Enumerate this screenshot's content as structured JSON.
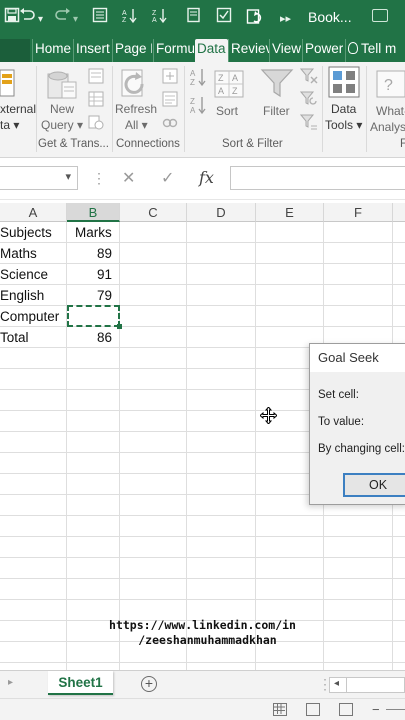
{
  "titlebar": {
    "save_icon": "save-icon",
    "undo_icon": "undo-icon",
    "redo_icon": "redo-icon",
    "document_title": "Book..."
  },
  "tabs": [
    {
      "label": "Home",
      "active": false
    },
    {
      "label": "Insert",
      "active": false
    },
    {
      "label": "Page L",
      "active": false
    },
    {
      "label": "Formu",
      "active": false
    },
    {
      "label": "Data",
      "active": true
    },
    {
      "label": "Reviev",
      "active": false
    },
    {
      "label": "View",
      "active": false
    },
    {
      "label": "Power",
      "active": false
    }
  ],
  "tell_me": "Tell m",
  "ribbon": {
    "external_data": {
      "line1": "xternal",
      "line2": "ta ▾"
    },
    "new_query": {
      "line1": "New",
      "line2": "Query ▾"
    },
    "refresh_all": {
      "line1": "Refresh",
      "line2": "All ▾"
    },
    "sort": "Sort",
    "filter": "Filter",
    "data_tools": {
      "line1": "Data",
      "line2": "Tools ▾"
    },
    "what_if": {
      "line1": "What-",
      "line2": "Analys"
    },
    "groups": {
      "get_transform": "Get & Trans...",
      "connections": "Connections",
      "sort_filter": "Sort & Filter",
      "forecast": "F"
    }
  },
  "formula_bar": {
    "name_box": "",
    "cancel": "✕",
    "enter": "✓",
    "fx": "fx",
    "formula": ""
  },
  "columns": [
    "A",
    "B",
    "C",
    "D",
    "E",
    "F"
  ],
  "sheet": {
    "rows": [
      {
        "a": "Subjects",
        "b": "Marks"
      },
      {
        "a": "Maths",
        "b": "89"
      },
      {
        "a": "Science",
        "b": "91"
      },
      {
        "a": "English",
        "b": "79"
      },
      {
        "a": "Computer",
        "b": ""
      },
      {
        "a": "Total",
        "b": "86"
      }
    ]
  },
  "dialog": {
    "title": "Goal Seek",
    "set_cell": "Set cell:",
    "to_value": "To value:",
    "by_changing": "By changing cell:",
    "ok": "OK"
  },
  "watermark": {
    "line1": "https://www.linkedin.com/in",
    "line2": "/zeeshanmuhammadkhan"
  },
  "sheet_tabs": {
    "active": "Sheet1",
    "add": "+"
  },
  "colors": {
    "excel_green": "#217346",
    "dialog_focus": "#3c7fc1"
  }
}
